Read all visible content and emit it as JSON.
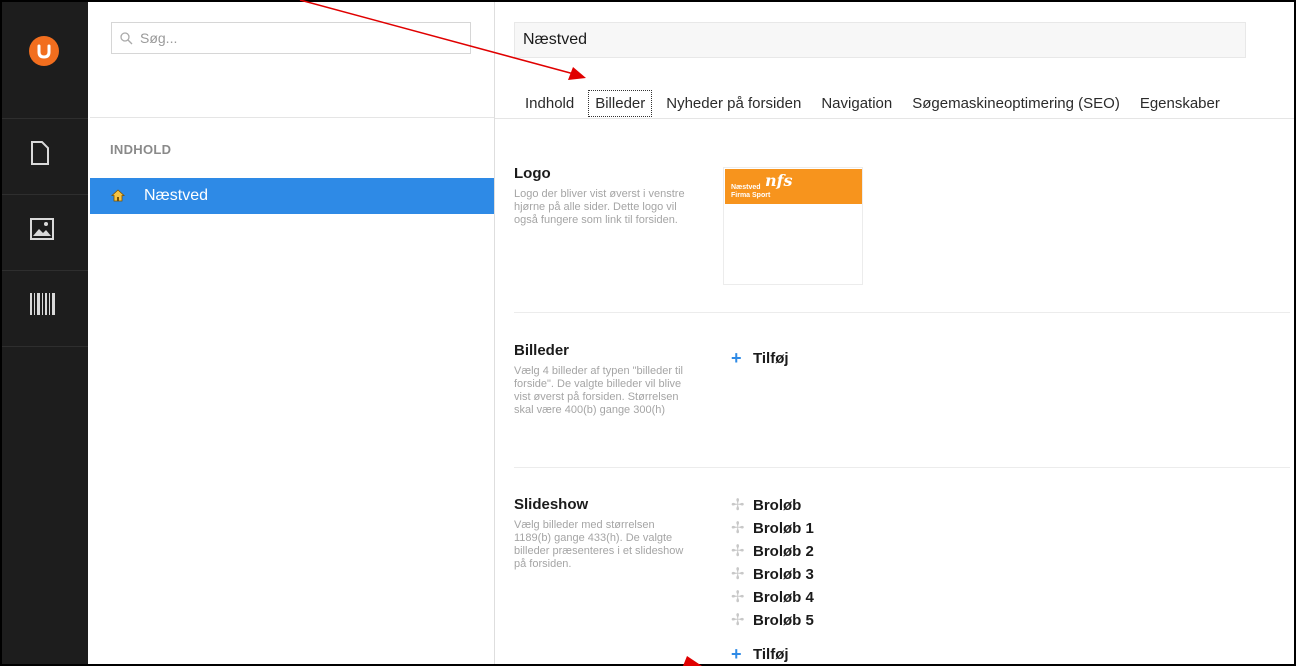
{
  "rail": {
    "items": [
      {
        "name": "content-section",
        "icon": "document-icon"
      },
      {
        "name": "media-section",
        "icon": "image-icon"
      },
      {
        "name": "barcode-section",
        "icon": "barcode-icon"
      }
    ]
  },
  "tree": {
    "search": {
      "placeholder": "Søg..."
    },
    "heading": "INDHOLD",
    "items": [
      {
        "label": "Næstved",
        "icon": "home-icon",
        "selected": true
      }
    ]
  },
  "editor": {
    "name_value": "Næstved",
    "tabs": [
      {
        "label": "Indhold"
      },
      {
        "label": "Billeder",
        "active": true
      },
      {
        "label": "Nyheder på forsiden"
      },
      {
        "label": "Navigation"
      },
      {
        "label": "Søgemaskineoptimering (SEO)"
      },
      {
        "label": "Egenskaber"
      }
    ],
    "properties": {
      "logo": {
        "title": "Logo",
        "description": "Logo der bliver vist øverst i venstre hjørne på alle sider. Dette logo vil også fungere som link til forsiden.",
        "image": {
          "mark": "nfs",
          "line1": "Næstved",
          "line2": "Firma Sport"
        }
      },
      "images": {
        "title": "Billeder",
        "description": "Vælg 4 billeder af typen \"billeder til forside\". De valgte billeder vil blive vist øverst på forsiden. Størrelsen skal være 400(b) gange 300(h)",
        "add_label": "Tilføj"
      },
      "slideshow": {
        "title": "Slideshow",
        "description": "Vælg billeder med størrelsen 1189(b) gange 433(h). De valgte billeder præsenteres i et slideshow på forsiden.",
        "items": [
          "Broløb",
          "Broløb 1",
          "Broløb 2",
          "Broløb 3",
          "Broløb 4",
          "Broløb 5"
        ],
        "add_label": "Tilføj"
      }
    }
  },
  "colors": {
    "accent_blue": "#2e8ae6",
    "brand_orange": "#f26e1e",
    "logo_orange": "#f7941d",
    "rail_dark": "#1d1d1d",
    "annotation_red": "#e00000"
  }
}
